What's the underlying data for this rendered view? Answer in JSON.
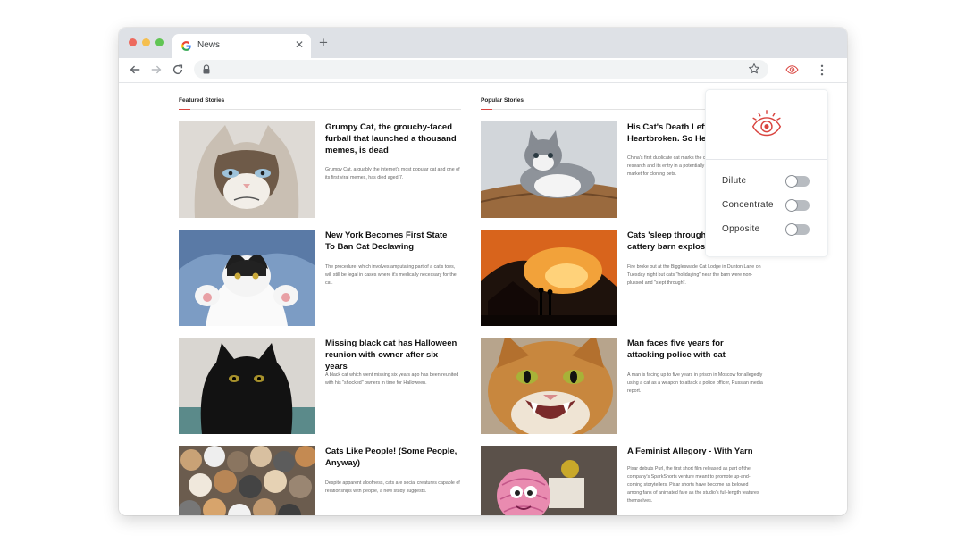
{
  "browser": {
    "tab_title": "News",
    "tab_close": "✕",
    "new_tab": "+",
    "favicon": "google-g-icon",
    "url": ""
  },
  "sections": {
    "featured": "Featured Stories",
    "popular": "Popular Stories"
  },
  "featured": [
    {
      "title": "Grumpy Cat, the grouchy-faced furball that launched a thousand memes, is dead",
      "desc": "Grumpy Cat, arguably the internet's most popular cat and one of its first viral memes, has died aged 7.",
      "image": "grumpy-cat-photo"
    },
    {
      "title": "New York Becomes First State To Ban Cat Declawing",
      "desc": "The procedure, which involves amputating part of a cat's toes, will still be legal in cases where it's medically necessary for the cat.",
      "image": "cat-paws-photo"
    },
    {
      "title": "Missing black cat has Halloween reunion with owner after six years",
      "desc": "A black cat which went missing six years ago has been reunited with his \"shocked\" owners in time for Halloween.",
      "image": "black-cat-photo"
    },
    {
      "title": "Cats Like People! (Some People, Anyway)",
      "desc": "Despite apparent aloofness, cats are social creatures capable of relationships with people, a new study suggests.",
      "image": "many-cats-photo"
    }
  ],
  "popular": [
    {
      "title": "His Cat's Death Left Him Heartbroken. So He Cloned It",
      "desc": "China's first duplicate cat marks the country's latest step in gene research and its entry in a potentially lucrative, unregulated market for cloning pets.",
      "image": "grey-kitten-photo"
    },
    {
      "title": "Cats 'sleep through' Bigglesw cattery barn explosion",
      "desc": "Fire broke out at the Biggleswade Cat Lodge in Dunton Lane on Tuesday night but cats \"holidaying\" near the barn were non-plussed and \"slept through\".",
      "image": "barn-fire-photo"
    },
    {
      "title": "Man faces five years for attacking police with cat",
      "desc": "A man is facing up to five years in prison in Moscow for allegedly using a cat as a weapon to attack a police officer, Russian media report.",
      "image": "hissing-cat-photo"
    },
    {
      "title": "A Feminist Allegory - With Yarn",
      "desc": "Pixar debuts Purl, the first short film released as part of the company's SparkShorts venture meant to promote up-and-coming storytellers. Pixar shorts have become as beloved among fans of animated fare as the studio's full-length features themselves.",
      "image": "yarn-ball-character-photo"
    }
  ],
  "extension_panel": {
    "icon": "eye-icon",
    "options": [
      {
        "label": "Dilute",
        "on": false
      },
      {
        "label": "Concentrate",
        "on": false
      },
      {
        "label": "Opposite",
        "on": false
      }
    ]
  },
  "colors": {
    "accent": "#d9443f",
    "tabstrip": "#dee1e6",
    "omnibox": "#f1f3f4",
    "toggle_track": "#b8bcc1"
  }
}
